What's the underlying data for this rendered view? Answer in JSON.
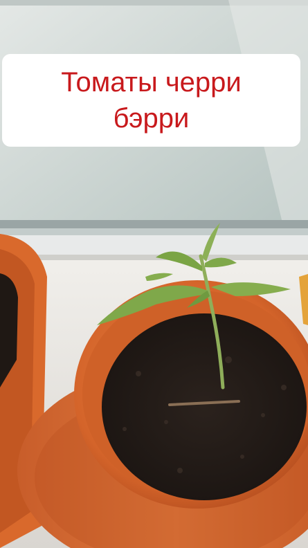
{
  "caption": {
    "line1": "Томаты черри",
    "line2": "бэрри"
  },
  "colors": {
    "caption_text": "#c8191c",
    "caption_bg": "#ffffff",
    "pot": "#d9692c",
    "soil": "#231c18",
    "seedling": "#7ea64a",
    "window_glass": "#c9d3d1"
  }
}
